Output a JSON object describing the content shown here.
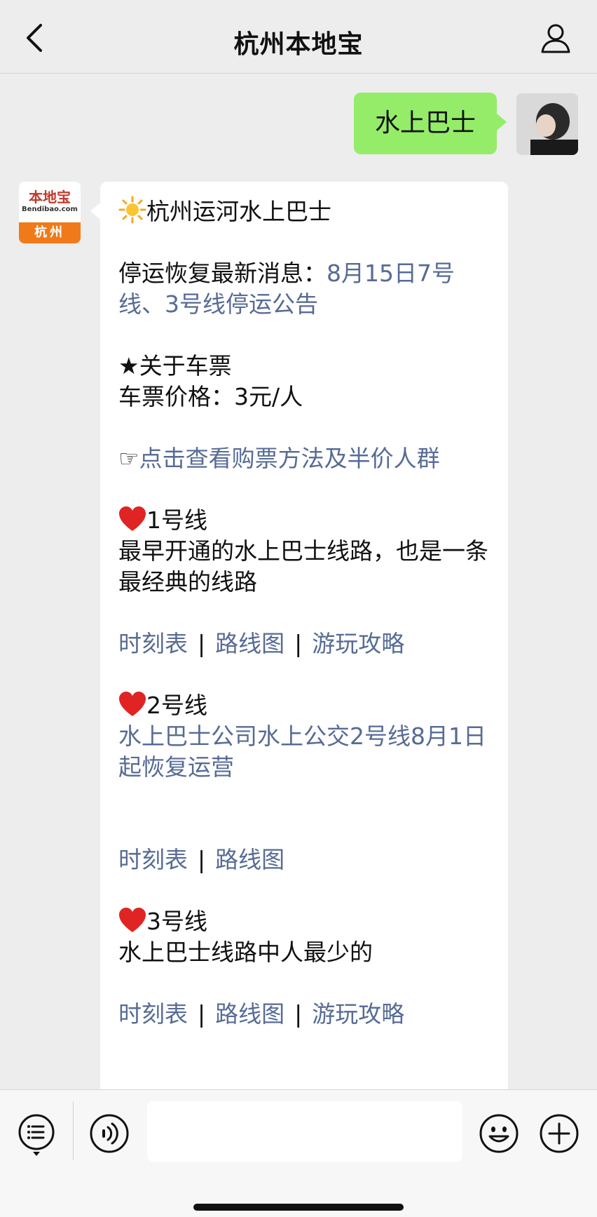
{
  "header": {
    "title": "杭州本地宝"
  },
  "outgoing": {
    "text": "水上巴士"
  },
  "account_logo": {
    "name": "本地宝",
    "site": "Bendibao.com",
    "city": "杭州"
  },
  "message": {
    "title": "杭州运河水上巴士",
    "notice_label": "停运恢复最新消息：",
    "notice_link": "8月15日7号线、3号线停运公告",
    "ticket_heading": "★关于车票",
    "ticket_price": "车票价格：3元/人",
    "ticket_link_icon": "☞",
    "ticket_link": "点击查看购票方法及半价人群",
    "line1": {
      "title": "1号线",
      "desc": "最早开通的水上巴士线路，也是一条最经典的线路",
      "links": [
        "时刻表",
        "路线图",
        "游玩攻略"
      ]
    },
    "line2": {
      "title": "2号线",
      "news_link": "水上巴士公司水上公交2号线8月1日起恢复运营",
      "links": [
        "时刻表",
        "路线图"
      ]
    },
    "line3": {
      "title": "3号线",
      "desc": "水上巴士线路中人最少的",
      "links": [
        "时刻表",
        "路线图",
        "游玩攻略"
      ]
    },
    "separator": "|"
  },
  "input": {
    "placeholder": ""
  },
  "colors": {
    "background": "#ededed",
    "outgoing_bubble": "#95ec69",
    "link": "#576b95",
    "logo_orange": "#f07a1a",
    "logo_red": "#c0392b"
  },
  "icons": {
    "back": "chevron-left-icon",
    "profile": "person-icon",
    "menu": "menu-icon",
    "voice": "voice-icon",
    "emoji": "emoji-icon",
    "plus": "plus-icon"
  }
}
